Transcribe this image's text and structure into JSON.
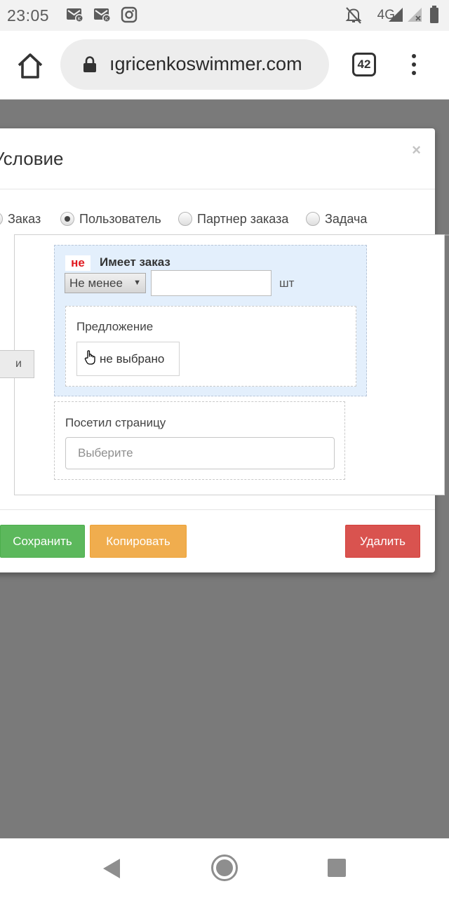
{
  "status_bar": {
    "time": "23:05",
    "network": "4G",
    "icons": [
      "mail-icon",
      "mail-icon",
      "instagram-icon",
      "bell-off-icon",
      "signal-icon",
      "signal-x-icon",
      "battery-icon"
    ]
  },
  "browser": {
    "url": "ıgricenkoswimmer.com",
    "tab_count": "42",
    "icons": [
      "home-icon",
      "lock-icon",
      "tabs-icon",
      "menu-icon"
    ]
  },
  "modal": {
    "title": "Условие",
    "close": "×",
    "radios": [
      {
        "label": "Заказ",
        "checked": false
      },
      {
        "label": "Пользователь",
        "checked": true
      },
      {
        "label": "Партнер заказа",
        "checked": false
      },
      {
        "label": "Задача",
        "checked": false
      }
    ],
    "and_button": "и",
    "has_order": {
      "negation": "не",
      "title": "Имеет заказ",
      "comparator": "Не менее",
      "quantity": "",
      "unit": "шт",
      "offer": {
        "label": "Предложение",
        "button": "не выбрано"
      }
    },
    "visited_page": {
      "label": "Посетил страницу",
      "placeholder": "Выберите"
    },
    "buttons": {
      "save": "Сохранить",
      "copy": "Копировать",
      "delete": "Удалить"
    },
    "colors": {
      "save": "#5cb85c",
      "copy": "#f0ad4e",
      "delete": "#d9534f",
      "negation": "#e0191f",
      "highlight": "#e3effc"
    }
  },
  "nav_bar": {
    "icons": [
      "back-icon",
      "home-circle-icon",
      "recent-apps-icon"
    ]
  }
}
